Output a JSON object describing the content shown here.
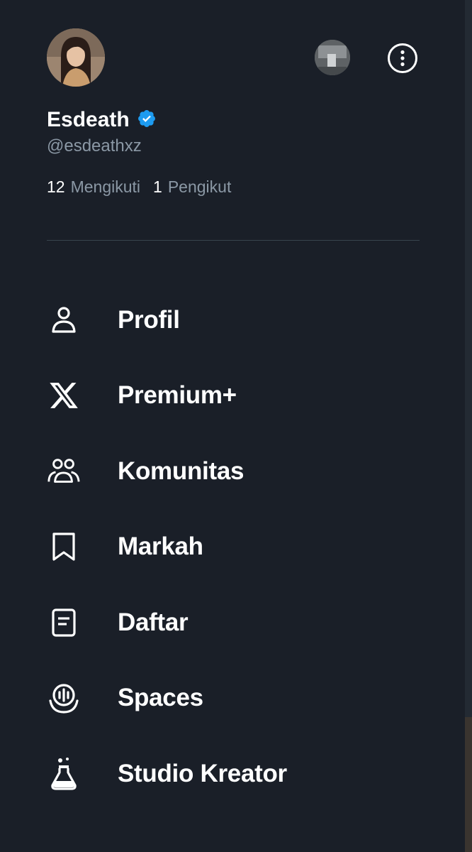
{
  "profile": {
    "name": "Esdeath",
    "handle": "@esdeathxz",
    "verified_color": "#1d9bf0",
    "following_count": "12",
    "following_label": "Mengikuti",
    "followers_count": "1",
    "followers_label": "Pengikut"
  },
  "menu": {
    "items": [
      {
        "label": "Profil",
        "icon": "person-icon"
      },
      {
        "label": "Premium+",
        "icon": "x-logo-icon"
      },
      {
        "label": "Komunitas",
        "icon": "communities-icon"
      },
      {
        "label": "Markah",
        "icon": "bookmark-icon"
      },
      {
        "label": "Daftar",
        "icon": "list-icon"
      },
      {
        "label": "Spaces",
        "icon": "spaces-icon"
      },
      {
        "label": "Studio Kreator",
        "icon": "flask-icon"
      }
    ]
  },
  "colors": {
    "background": "#1a1f28",
    "primary_text": "#ffffff",
    "secondary_text": "#8b98a5",
    "divider": "#38444d"
  }
}
